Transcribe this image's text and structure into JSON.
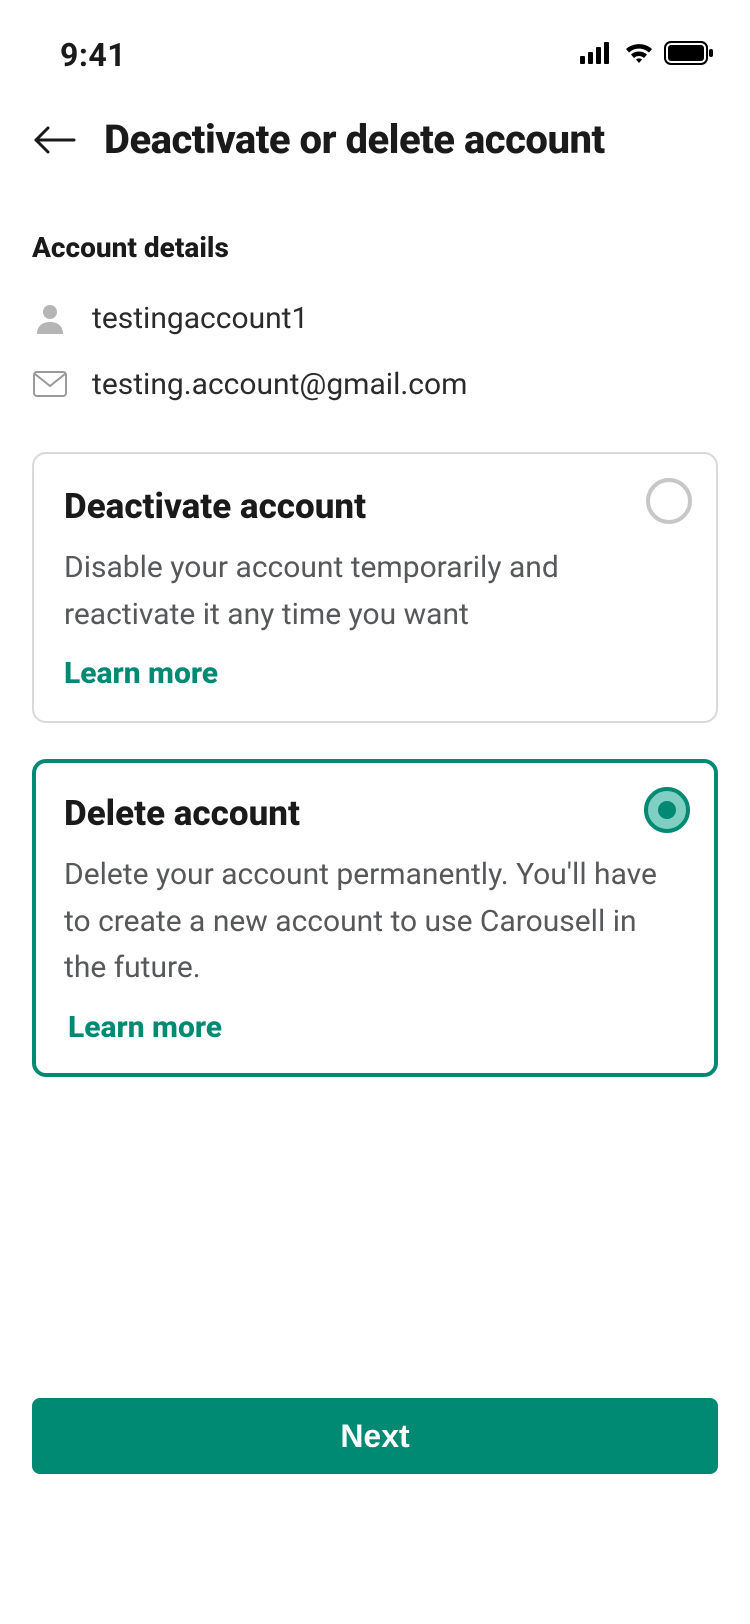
{
  "status": {
    "time": "9:41"
  },
  "header": {
    "title": "Deactivate or delete account"
  },
  "accountDetails": {
    "sectionLabel": "Account details",
    "username": "testingaccount1",
    "email": "testing.account@gmail.com"
  },
  "options": {
    "deactivate": {
      "title": "Deactivate account",
      "description": "Disable your account temporarily and reactivate it any time you want",
      "learnMore": "Learn more",
      "selected": false
    },
    "delete": {
      "title": "Delete account",
      "description": "Delete your account permanently. You'll have to create a new account to use Carousell in the future.",
      "learnMore": "Learn more",
      "selected": true
    }
  },
  "footer": {
    "nextLabel": "Next"
  },
  "colors": {
    "accent": "#008a73"
  }
}
